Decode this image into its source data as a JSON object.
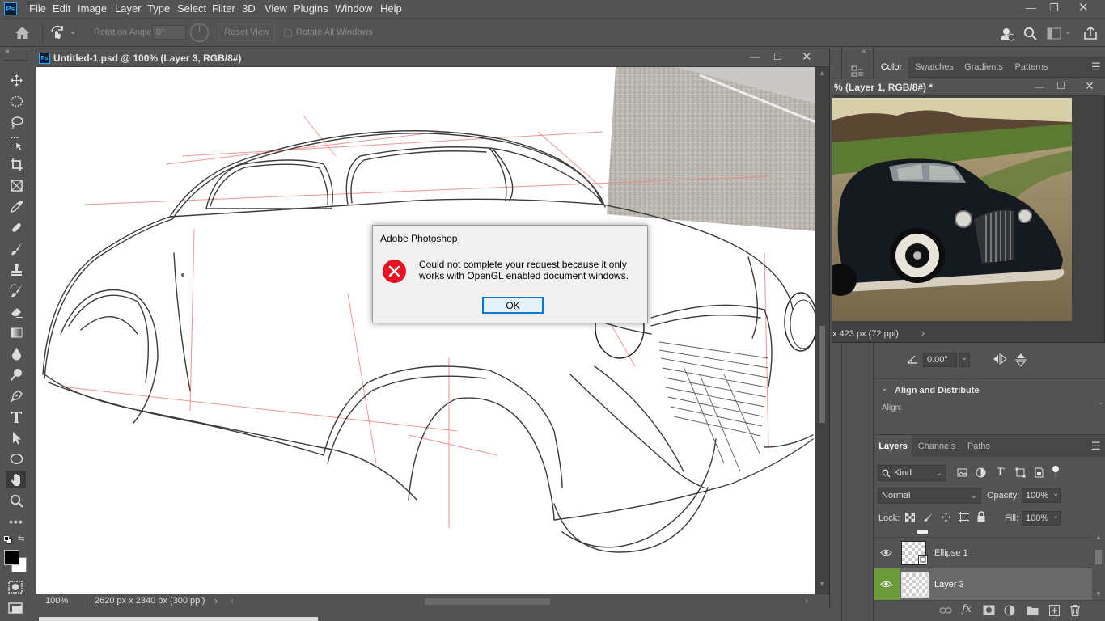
{
  "menu": {
    "items": [
      "File",
      "Edit",
      "Image",
      "Layer",
      "Type",
      "Select",
      "Filter",
      "3D",
      "View",
      "Plugins",
      "Window",
      "Help"
    ]
  },
  "options_bar": {
    "rotation_label": "Rotation Angle:",
    "rotation_value": "0°",
    "reset_view": "Reset View",
    "rotate_all": "Rotate All Windows"
  },
  "document": {
    "title": "Untitled-1.psd @ 100% (Layer 3, RGB/8#)",
    "zoom": "100%",
    "dimensions": "2620 px x 2340 px (300 ppi)"
  },
  "second_document": {
    "title": "% (Layer 1, RGB/8#) *",
    "status": "x 423 px (72 ppi)"
  },
  "panels": {
    "top_tabs": [
      "Color",
      "Swatches",
      "Gradients",
      "Patterns"
    ],
    "angle_value": "0.00°",
    "align_title": "Align and Distribute",
    "align_label": "Align:",
    "layer_tabs": [
      "Layers",
      "Channels",
      "Paths"
    ],
    "kind_filter": "Kind",
    "blend_mode": "Normal",
    "opacity_label": "Opacity:",
    "opacity_value": "100%",
    "lock_label": "Lock:",
    "fill_label": "Fill:",
    "fill_value": "100%"
  },
  "layers": [
    {
      "name": "Ellipse 1",
      "selected": false
    },
    {
      "name": "Layer 3",
      "selected": true
    }
  ],
  "dialog": {
    "title": "Adobe Photoshop",
    "message_line1": "Could not complete your request because it only",
    "message_line2": "works with OpenGL enabled document windows.",
    "ok": "OK"
  },
  "colors": {
    "ui_bg": "#535353",
    "selected_layer_eye": "#6b9a3c",
    "error_red": "#e81123"
  }
}
